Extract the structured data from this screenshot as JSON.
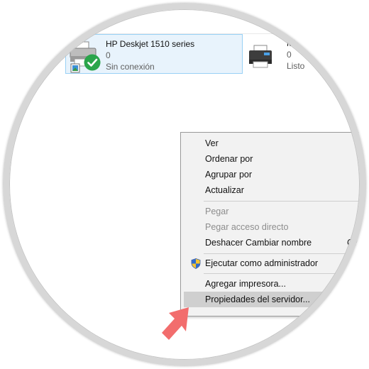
{
  "printers": [
    {
      "name": "HP Deskjet 1510 series",
      "jobs": "0",
      "status": "Sin conexión",
      "selected": true,
      "badge": "default-check-badge"
    },
    {
      "name": "Mi",
      "jobs": "0",
      "status": "Listo",
      "selected": false
    }
  ],
  "context_menu": {
    "items": [
      {
        "label": "Ver",
        "enabled": true
      },
      {
        "label": "Ordenar por",
        "enabled": true
      },
      {
        "label": "Agrupar por",
        "enabled": true
      },
      {
        "label": "Actualizar",
        "enabled": true
      },
      {
        "label": "Pegar",
        "enabled": false
      },
      {
        "label": "Pegar acceso directo",
        "enabled": false
      },
      {
        "label": "Deshacer Cambiar nombre",
        "enabled": true,
        "shortcut": "Ctrl"
      },
      {
        "label": "Ejecutar como administrador",
        "enabled": true,
        "icon": "uac-shield-icon"
      },
      {
        "label": "Agregar impresora...",
        "enabled": true
      },
      {
        "label": "Propiedades del servidor...",
        "enabled": true,
        "highlighted": true
      }
    ]
  },
  "colors": {
    "selection_fill": "#e8f3fc",
    "selection_border": "#99d1f5",
    "menu_background": "#f2f2f2",
    "menu_highlight": "#cfcfcf",
    "check_badge": "#2aa54b",
    "pointer_arrow": "#f26d6d"
  }
}
